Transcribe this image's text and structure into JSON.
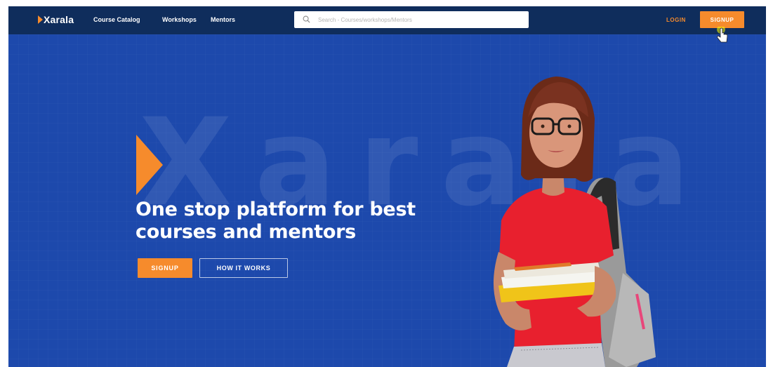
{
  "navbar": {
    "logo_text": "Xarala",
    "links": [
      "Course Catalog",
      "Workshops",
      "Mentors"
    ],
    "search_placeholder": "Search - Courses/workshops/Mentors",
    "login_label": "LOGIN",
    "signup_label": "SIGNUP"
  },
  "hero": {
    "watermark": "Xarala",
    "headline_line1": "One stop platform for best",
    "headline_line2": "courses and mentors",
    "signup_button": "SIGNUP",
    "how_it_works_button": "HOW IT WORKS"
  },
  "icons": {
    "search": "search-icon",
    "cursor": "pointer-cursor-icon",
    "brand": "brand-arrow-icon"
  },
  "colors": {
    "navbar_bg": "#0f2d5c",
    "hero_bg": "#1d49ac",
    "accent": "#f68b2c",
    "text_light": "#ffffff"
  }
}
